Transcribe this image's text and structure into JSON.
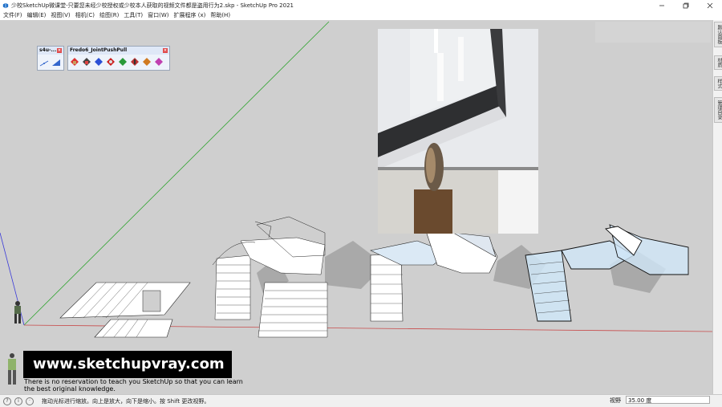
{
  "window": {
    "title": "少校SketchUp微课堂-只要您未经少校授权或少校本人获取的视频文件都是盗用行为2.skp - SketchUp Pro 2021"
  },
  "menu": {
    "items": [
      "文件(F)",
      "编辑(E)",
      "视图(V)",
      "相机(C)",
      "绘图(R)",
      "工具(T)",
      "窗口(W)",
      "扩展程序 (x)",
      "帮助(H)"
    ]
  },
  "toolbars": {
    "small": {
      "title": "s4u-..."
    },
    "fredo": {
      "title": "Fredo6_JointPushPull"
    }
  },
  "tray": {
    "tabs": [
      "默认面板",
      "材质",
      "样式",
      "管理目录"
    ]
  },
  "watermark": {
    "url": "www.sketchupvray.com",
    "line1": "There is no reservation to teach you SketchUp so that you can learn",
    "line2": "the best original knowledge."
  },
  "status": {
    "hint": "拖动光标进行缩放。向上是放大，向下是缩小。按 Shift 更改视野。",
    "vcb_label": "视野",
    "vcb_value": "35.00 度"
  },
  "colors": {
    "viewport_bg": "#cfcfcf",
    "green_axis": "#2fa32f",
    "red_axis": "#c84a4a",
    "blue_axis": "#3b3bd8",
    "glass": "#cfe6f7"
  }
}
